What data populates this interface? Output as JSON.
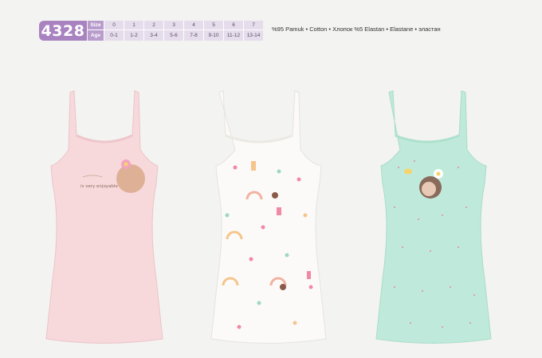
{
  "product_code": "4328",
  "size_table": {
    "size_label": "Size",
    "age_label": "Age",
    "sizes": [
      "0",
      "1",
      "2",
      "3",
      "4",
      "5",
      "6",
      "7"
    ],
    "ages": [
      "0-1",
      "1-2",
      "3-4",
      "5-6",
      "7-8",
      "9-10",
      "11-12",
      "13-14"
    ]
  },
  "fabric_text": "%95 Pamuk • Cotton • Хлопок %5 Elastan • Elastane • эластан",
  "colors": {
    "badge": "#a883c0",
    "shirt_pink": "#f7d9dc",
    "shirt_white": "#fbfaf8",
    "shirt_mint": "#bfeadb"
  },
  "shirts": [
    {
      "color_name": "pink",
      "print": "hedgehog-with-flower",
      "print_text": "is very enjoyable"
    },
    {
      "color_name": "white",
      "print": "allover-rainbows-and-animals"
    },
    {
      "color_name": "mint",
      "print": "hedgehog-with-daisy-and-bee"
    }
  ]
}
